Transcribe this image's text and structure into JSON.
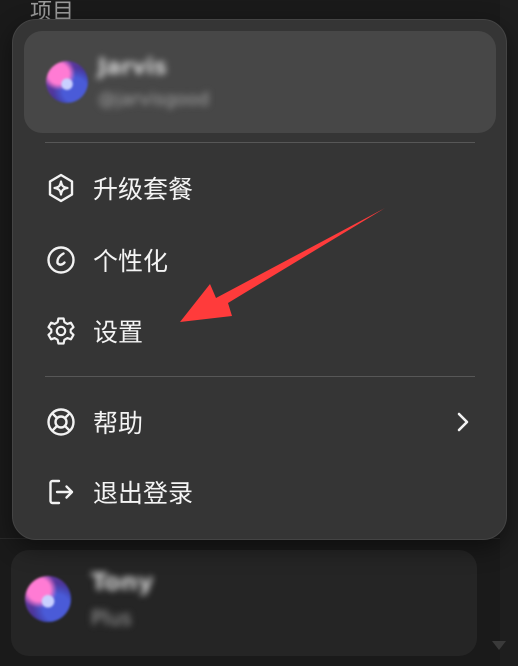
{
  "background": {
    "title": "项目"
  },
  "account": {
    "name": "Jarvis",
    "handle": "@jarvisgood"
  },
  "menu": {
    "items": [
      {
        "label": "升级套餐",
        "icon": "sparkle-hexagon-icon"
      },
      {
        "label": "个性化",
        "icon": "personalize-icon"
      },
      {
        "label": "设置",
        "icon": "gear-icon"
      },
      {
        "label": "帮助",
        "icon": "lifebuoy-icon",
        "has_submenu": true
      },
      {
        "label": "退出登录",
        "icon": "logout-icon"
      }
    ]
  },
  "profile": {
    "name": "Tony",
    "plan": "Plus"
  },
  "colors": {
    "annotation_arrow": "#ff3b3b",
    "menu_bg": "#353535",
    "card_bg": "#474747"
  }
}
